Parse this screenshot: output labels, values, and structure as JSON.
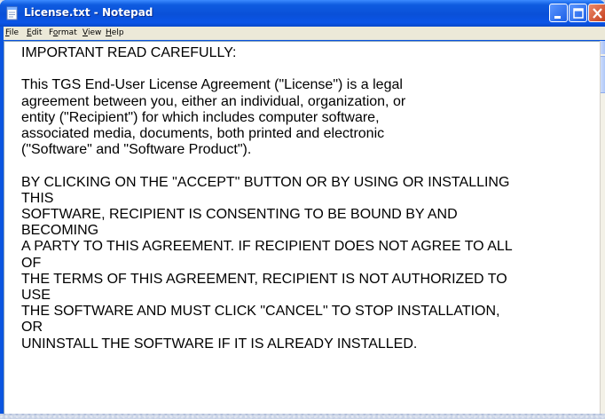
{
  "window": {
    "title": "License.txt - Notepad",
    "title_color": "#ffffff",
    "titlebar_color": "#0a50d8"
  },
  "app_icon": "notepad-icon",
  "title_buttons": [
    {
      "name": "minimize",
      "icon": "minimize-icon"
    },
    {
      "name": "maximize",
      "icon": "maximize-icon"
    },
    {
      "name": "close",
      "icon": "close-icon"
    }
  ],
  "menu": {
    "file": {
      "accel": "F",
      "rest": "ile"
    },
    "edit": {
      "accel": "E",
      "rest": "dit"
    },
    "format": {
      "pre": "F",
      "accel": "o",
      "rest": "rmat"
    },
    "view": {
      "accel": "V",
      "rest": "iew"
    },
    "help": {
      "accel": "H",
      "rest": "elp"
    }
  },
  "document": {
    "text": "IMPORTANT READ CAREFULLY:\n\nThis TGS End-User License Agreement (\"License\") is a legal\nagreement between you, either an individual, organization, or\nentity (\"Recipient\") for which includes computer software,\nassociated media, documents, both printed and electronic\n(\"Software\" and \"Software Product\").\n\nBY CLICKING ON THE \"ACCEPT\" BUTTON OR BY USING OR INSTALLING\nTHIS\nSOFTWARE, RECIPIENT IS CONSENTING TO BE BOUND BY AND\nBECOMING\nA PARTY TO THIS AGREEMENT. IF RECIPIENT DOES NOT AGREE TO ALL\nOF\nTHE TERMS OF THIS AGREEMENT, RECIPIENT IS NOT AUTHORIZED TO\nUSE\nTHE SOFTWARE AND MUST CLICK \"CANCEL\" TO STOP INSTALLATION,\nOR\nUNINSTALL THE SOFTWARE IF IT IS ALREADY INSTALLED."
  }
}
